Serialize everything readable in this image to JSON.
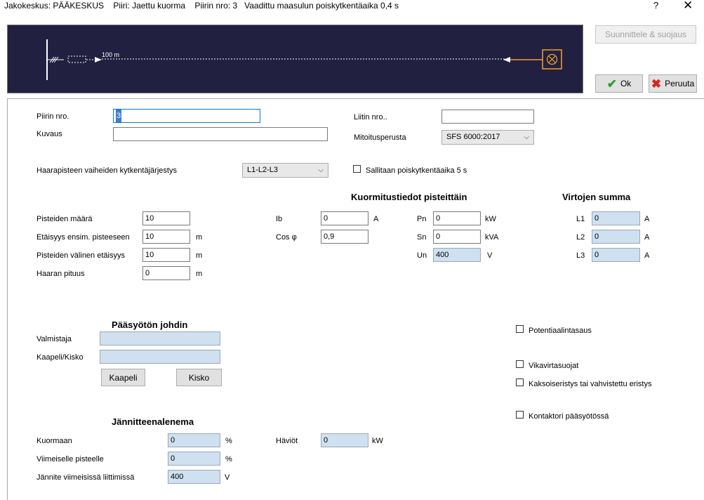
{
  "window": {
    "title": "Jakokeskus: PÄÄKESKUS    Piiri: Jaettu kuorma    Piirin nro: 3   Vaadittu maasulun poiskytkentäaika 0,4 s",
    "help_label": "?",
    "close_label": "✕"
  },
  "diagram": {
    "distance_label": "100 m"
  },
  "buttons": {
    "design": "Suunnittele & suojaus",
    "ok": "Ok",
    "cancel": "Peruuta",
    "cable": "Kaapeli",
    "busbar": "Kisko"
  },
  "form": {
    "circuit_no_label": "Piirin nro.",
    "circuit_no_value": "3",
    "description_label": "Kuvaus",
    "description_value": "",
    "terminal_no_label": "Liitin nro..",
    "terminal_no_value": "",
    "sizing_basis_label": "Mitoitusperusta",
    "sizing_basis_value": "SFS 6000:2017",
    "phase_order_label": "Haarapisteen vaiheiden kytkentäjärjestys",
    "phase_order_value": "L1-L2-L3",
    "allow_5s_label": "Sallitaan poiskytkentäaika 5 s"
  },
  "branch": {
    "points_count_label": "Pisteiden määrä",
    "points_count_value": "10",
    "distance_first_label": "Etäisyys ensim. pisteeseen",
    "distance_first_value": "10",
    "distance_first_unit": "m",
    "distance_between_label": "Pisteiden välinen etäisyys",
    "distance_between_value": "10",
    "distance_between_unit": "m",
    "branch_length_label": "Haaran pituus",
    "branch_length_value": "0",
    "branch_length_unit": "m"
  },
  "load": {
    "heading": "Kuormitustiedot pisteittäin",
    "ib_label": "Ib",
    "ib_value": "0",
    "ib_unit": "A",
    "cos_label": "Cos φ",
    "cos_value": "0,9",
    "pn_label": "Pn",
    "pn_value": "0",
    "pn_unit": "kW",
    "sn_label": "Sn",
    "sn_value": "0",
    "sn_unit": "kVA",
    "un_label": "Un",
    "un_value": "400",
    "un_unit": "V"
  },
  "currents": {
    "heading": "Virtojen summa",
    "l1_label": "L1",
    "l1_value": "0",
    "l1_unit": "A",
    "l2_label": "L2",
    "l2_value": "0",
    "l2_unit": "A",
    "l3_label": "L3",
    "l3_value": "0",
    "l3_unit": "A"
  },
  "feeder": {
    "heading": "Pääsyötön johdin",
    "manufacturer_label": "Valmistaja",
    "manufacturer_value": "",
    "cable_label": "Kaapeli/Kisko",
    "cable_value": ""
  },
  "options": {
    "potential_eq": "Potentiaalintasaus",
    "rcd": "Vikavirtasuojat",
    "double_insulation": "Kaksoiseristys tai vahvistettu eristys",
    "contactor": "Kontaktori pääsyötössä"
  },
  "voltage_drop": {
    "heading": "Jännitteenalenema",
    "load_label": "Kuormaan",
    "load_value": "0",
    "load_unit": "%",
    "last_point_label": "Viimeiselle pisteelle",
    "last_point_value": "0",
    "last_point_unit": "%",
    "last_terminal_voltage_label": "Jännite viimeisissä liittimissä",
    "last_terminal_voltage_value": "400",
    "last_terminal_voltage_unit": "V",
    "losses_label": "Häviöt",
    "losses_value": "0",
    "losses_unit": "kW"
  }
}
